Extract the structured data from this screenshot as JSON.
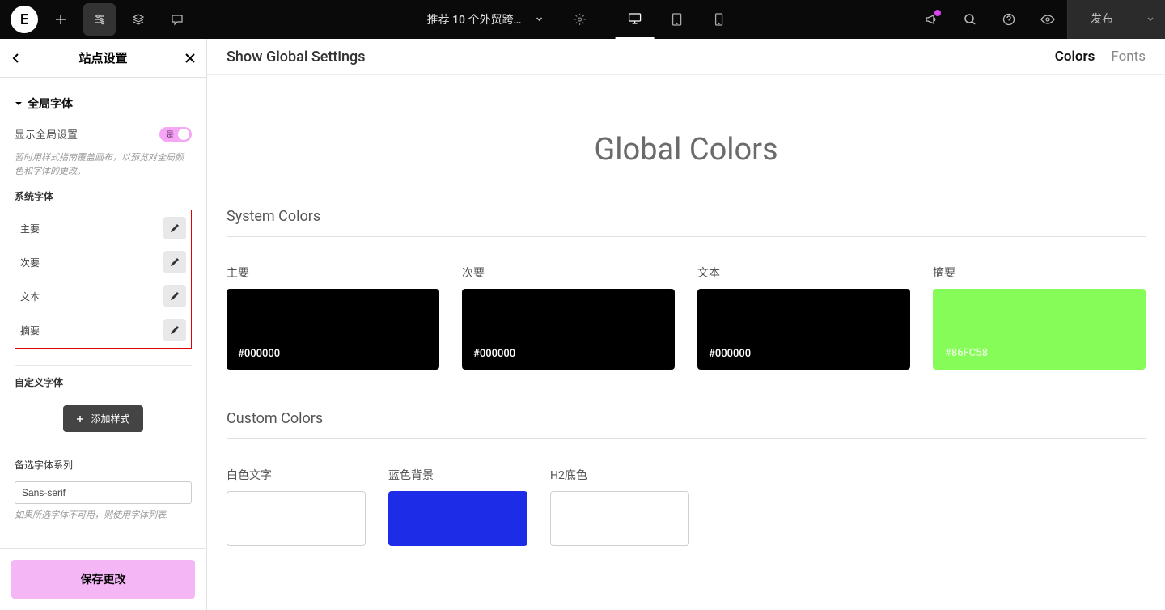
{
  "topbar": {
    "doc_title": "推荐 10 个外贸跨…",
    "publish": "发布"
  },
  "sidebar": {
    "title": "站点设置",
    "accordion": "全局字体",
    "toggle_label": "显示全局设置",
    "toggle_on": "是",
    "help": "暂时用样式指南覆盖画布，以预览对全局颜色和字体的更改。",
    "system_fonts_label": "系统字体",
    "fonts": [
      "主要",
      "次要",
      "文本",
      "摘要"
    ],
    "custom_fonts_label": "自定义字体",
    "add_style": "添加样式",
    "fallback_label": "备选字体系列",
    "fallback_value": "Sans-serif",
    "fallback_help": "如果所选字体不可用，则使用字体列表.",
    "save": "保存更改"
  },
  "content": {
    "top_title": "Show Global Settings",
    "tabs": {
      "colors": "Colors",
      "fonts": "Fonts"
    },
    "hero": "Global Colors",
    "system_colors_hdr": "System Colors",
    "system_colors": [
      {
        "label": "主要",
        "hex": "#000000",
        "cls": "black"
      },
      {
        "label": "次要",
        "hex": "#000000",
        "cls": "black"
      },
      {
        "label": "文本",
        "hex": "#000000",
        "cls": "black"
      },
      {
        "label": "摘要",
        "hex": "#86FC58",
        "cls": "green"
      }
    ],
    "custom_colors_hdr": "Custom Colors",
    "custom_colors": [
      {
        "label": "白色文字",
        "cls": "white"
      },
      {
        "label": "蓝色背景",
        "cls": "blue"
      },
      {
        "label": "H2底色",
        "cls": "white"
      }
    ]
  }
}
